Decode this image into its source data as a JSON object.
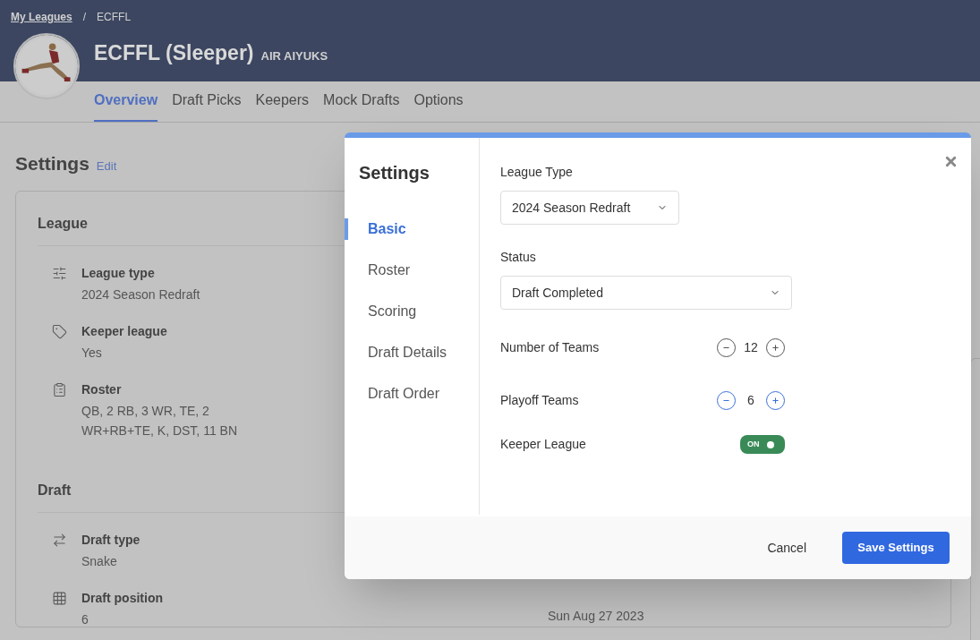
{
  "breadcrumb": {
    "items": [
      {
        "label": "My Leagues",
        "kind": "link"
      },
      {
        "label": "ECFFL",
        "kind": "current"
      }
    ],
    "separator": "/"
  },
  "league": {
    "name": "ECFFL (Sleeper)",
    "team": "AIR AIYUKS"
  },
  "tabs": [
    {
      "label": "Overview",
      "selected": true
    },
    {
      "label": "Draft Picks",
      "selected": false
    },
    {
      "label": "Keepers",
      "selected": false
    },
    {
      "label": "Mock Drafts",
      "selected": false
    },
    {
      "label": "Options",
      "selected": false
    }
  ],
  "settings": {
    "title": "Settings",
    "edit": "Edit",
    "sections": [
      {
        "title": "League",
        "items": [
          {
            "label": "League type",
            "value": "2024 Season Redraft"
          },
          {
            "label": "Keeper league",
            "value": "Yes"
          },
          {
            "label": "Roster",
            "value": "QB, 2 RB, 3 WR, TE, 2 WR+RB+TE, K, DST, 11 BN"
          }
        ]
      },
      {
        "title": "Draft",
        "items": [
          {
            "label": "Draft type",
            "value": "Snake"
          },
          {
            "label": "Draft position",
            "value": "6"
          }
        ],
        "side_text": "Sun Aug 27 2023"
      }
    ]
  },
  "modal": {
    "title": "Settings",
    "nav": [
      {
        "label": "Basic",
        "selected": true
      },
      {
        "label": "Roster",
        "selected": false
      },
      {
        "label": "Scoring",
        "selected": false
      },
      {
        "label": "Draft Details",
        "selected": false
      },
      {
        "label": "Draft Order",
        "selected": false
      }
    ],
    "selects": [
      {
        "label": "League Type",
        "value": "2024 Season Redraft"
      },
      {
        "label": "Status",
        "value": "Draft Completed"
      }
    ],
    "steppers": [
      {
        "label": "Number of Teams",
        "value": "12",
        "disabled": true
      },
      {
        "label": "Playoff Teams",
        "value": "6",
        "disabled": false
      }
    ],
    "toggle": {
      "label": "Keeper League",
      "on": true,
      "text": "ON"
    },
    "cancel": "Cancel",
    "save": "Save Settings"
  }
}
